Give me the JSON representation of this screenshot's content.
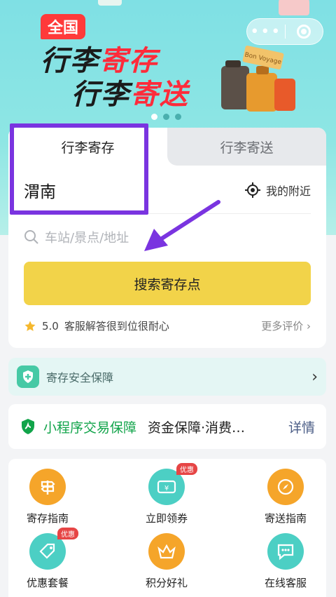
{
  "banner": {
    "badge": "全国",
    "line1_a": "行李",
    "line1_b": "寄存",
    "line2_a": "行李",
    "line2_b": "寄送",
    "suitcase_sticker": "Bon Voyage",
    "carousel_pages": 3,
    "carousel_active": 1
  },
  "capsule": {
    "more": "•••",
    "close_icon": "target-icon"
  },
  "card": {
    "tabs": [
      {
        "label": "行李寄存",
        "active": true
      },
      {
        "label": "行李寄送",
        "active": false
      }
    ],
    "city": "渭南",
    "nearby_label": "我的附近",
    "search_placeholder": "车站/景点/地址",
    "search_button": "搜索寄存点",
    "rating": "5.0",
    "review": "客服解答很到位很耐心",
    "more_reviews": "更多评价"
  },
  "safety": {
    "label": "寄存安全保障"
  },
  "trade": {
    "title": "小程序交易保障",
    "desc": "资金保障·消费…",
    "detail": "详情"
  },
  "grid": {
    "items": [
      {
        "label": "寄存指南",
        "icon": "signpost-icon",
        "color": "#f5a52a",
        "tag": ""
      },
      {
        "label": "立即领券",
        "icon": "coupon-icon",
        "color": "#4ccfc4",
        "tag": "优惠"
      },
      {
        "label": "寄送指南",
        "icon": "compass-icon",
        "color": "#f5a52a",
        "tag": ""
      },
      {
        "label": "优惠套餐",
        "icon": "price-tag-icon",
        "color": "#4ccfc4",
        "tag": "优惠"
      },
      {
        "label": "积分好礼",
        "icon": "crown-icon",
        "color": "#f5a52a",
        "tag": ""
      },
      {
        "label": "在线客服",
        "icon": "chat-icon",
        "color": "#4ccfc4",
        "tag": ""
      }
    ]
  },
  "colors": {
    "accent_yellow": "#f2d349",
    "highlight_purple": "#7a34e0",
    "trade_green": "#11a44a"
  }
}
